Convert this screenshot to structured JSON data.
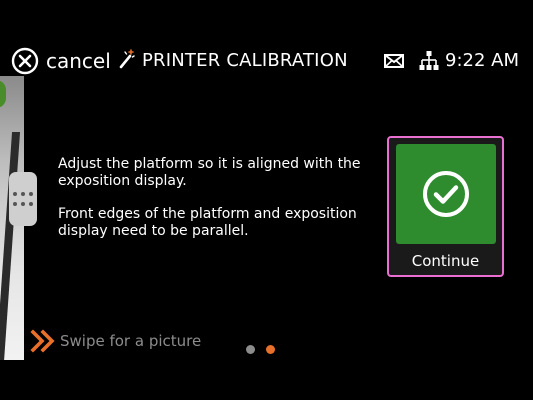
{
  "header": {
    "cancel_label": "cancel",
    "title": "PRINTER CALIBRATION",
    "time": "9:22 AM",
    "icons": {
      "cancel": "close-circle-icon",
      "title": "magic-wand-icon",
      "messages": "envelope-icon",
      "network": "network-icon"
    }
  },
  "instructions": {
    "paragraph1": "Adjust the platform so it is aligned with the exposition display.",
    "paragraph2": "Front edges of the platform and exposition display need to be parallel."
  },
  "continue_button": {
    "label": "Continue",
    "icon": "check-circle-icon",
    "tile_color": "#2e8b2e",
    "focus_border_color": "#e870d0"
  },
  "swipe_hint": {
    "label": "Swipe for a picture",
    "icon": "double-chevron-right-icon",
    "icon_color": "#e8702a"
  },
  "pager": {
    "page_count": 2,
    "active_page": 2,
    "active_color": "#e8702a",
    "inactive_color": "#8c8c8c"
  },
  "colors": {
    "background": "#000000",
    "text": "#ffffff",
    "muted_text": "#8c8c8c"
  }
}
